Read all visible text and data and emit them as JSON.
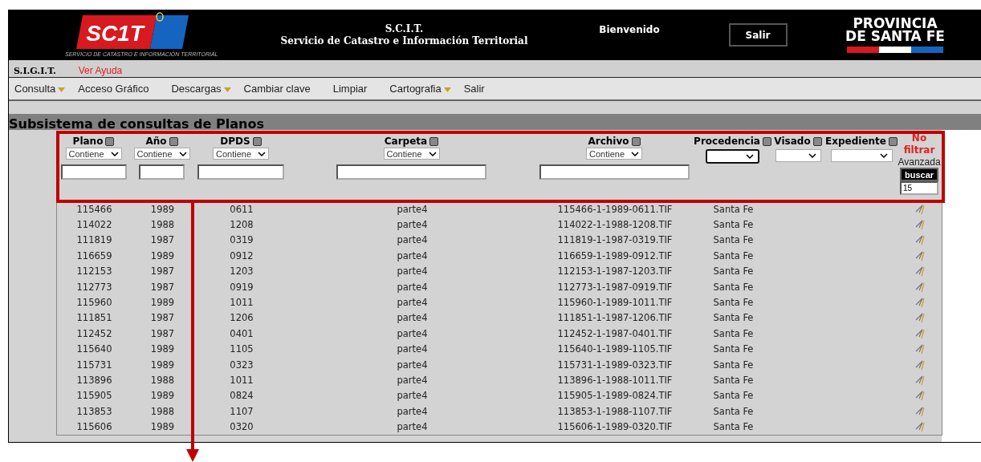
{
  "header": {
    "logo_text": "SC1T",
    "logo_subtitle": "SERVICIO DE CATASTRO E INFORMACIÓN TERRITORIAL",
    "title": "S.C.I.T.",
    "subtitle": "Servicio de Catastro e Información Territorial",
    "welcome": "Bienvenido",
    "logout": "Salir",
    "province": [
      "PROVINCIA",
      "DE SANTA FE"
    ]
  },
  "sub_bar": {
    "system": "S.I.G.I.T.",
    "help_link": "Ver Ayuda"
  },
  "menu": [
    {
      "label": "Consulta",
      "dropdown": true
    },
    {
      "label": "Acceso Gráfico",
      "dropdown": false
    },
    {
      "label": "Descargas",
      "dropdown": true
    },
    {
      "label": "Cambiar clave",
      "dropdown": false
    },
    {
      "label": "Limpiar",
      "dropdown": false
    },
    {
      "label": "Cartografia",
      "dropdown": true
    },
    {
      "label": "Salir",
      "dropdown": false
    }
  ],
  "page_title": "Subsistema de consultas de Planos",
  "filters": [
    {
      "kind": "text",
      "label": "Plano",
      "checked": false,
      "operator": "Contiene"
    },
    {
      "kind": "text",
      "label": "Año",
      "checked": false,
      "operator": "Contiene"
    },
    {
      "kind": "text",
      "label": "DPDS",
      "checked": false,
      "operator": "Contiene"
    },
    {
      "kind": "text",
      "label": "Carpeta",
      "checked": false,
      "operator": "Contiene"
    },
    {
      "kind": "text",
      "label": "Archivo",
      "checked": false,
      "operator": "Contiene"
    },
    {
      "kind": "select",
      "label": "Procedencia",
      "checked": false
    },
    {
      "kind": "select",
      "label": "Visado",
      "checked": false
    },
    {
      "kind": "select",
      "label": "Expediente",
      "checked": false
    }
  ],
  "actions": {
    "no_filter": "No filtrar",
    "advanced": "Avanzada",
    "search": "buscar",
    "page_size": "15"
  },
  "rows": [
    [
      "115466",
      "1989",
      "0611",
      "parte4",
      "115466-1-1989-0611.TIF",
      "Santa Fe"
    ],
    [
      "114022",
      "1988",
      "1208",
      "parte4",
      "114022-1-1988-1208.TIF",
      "Santa Fe"
    ],
    [
      "111819",
      "1987",
      "0319",
      "parte4",
      "111819-1-1987-0319.TIF",
      "Santa Fe"
    ],
    [
      "116659",
      "1989",
      "0912",
      "parte4",
      "116659-1-1989-0912.TIF",
      "Santa Fe"
    ],
    [
      "112153",
      "1987",
      "1203",
      "parte4",
      "112153-1-1987-1203.TIF",
      "Santa Fe"
    ],
    [
      "112773",
      "1987",
      "0919",
      "parte4",
      "112773-1-1987-0919.TIF",
      "Santa Fe"
    ],
    [
      "115960",
      "1989",
      "1011",
      "parte4",
      "115960-1-1989-1011.TIF",
      "Santa Fe"
    ],
    [
      "111851",
      "1987",
      "1206",
      "parte4",
      "111851-1-1987-1206.TIF",
      "Santa Fe"
    ],
    [
      "112452",
      "1987",
      "0401",
      "parte4",
      "112452-1-1987-0401.TIF",
      "Santa Fe"
    ],
    [
      "115640",
      "1989",
      "1105",
      "parte4",
      "115640-1-1989-1105.TIF",
      "Santa Fe"
    ],
    [
      "115731",
      "1989",
      "0323",
      "parte4",
      "115731-1-1989-0323.TIF",
      "Santa Fe"
    ],
    [
      "113896",
      "1988",
      "1011",
      "parte4",
      "113896-1-1988-1011.TIF",
      "Santa Fe"
    ],
    [
      "115905",
      "1989",
      "0824",
      "parte4",
      "115905-1-1989-0824.TIF",
      "Santa Fe"
    ],
    [
      "113853",
      "1988",
      "1107",
      "parte4",
      "113853-1-1988-1107.TIF",
      "Santa Fe"
    ],
    [
      "115606",
      "1989",
      "0320",
      "parte4",
      "115606-1-1989-0320.TIF",
      "Santa Fe"
    ]
  ]
}
